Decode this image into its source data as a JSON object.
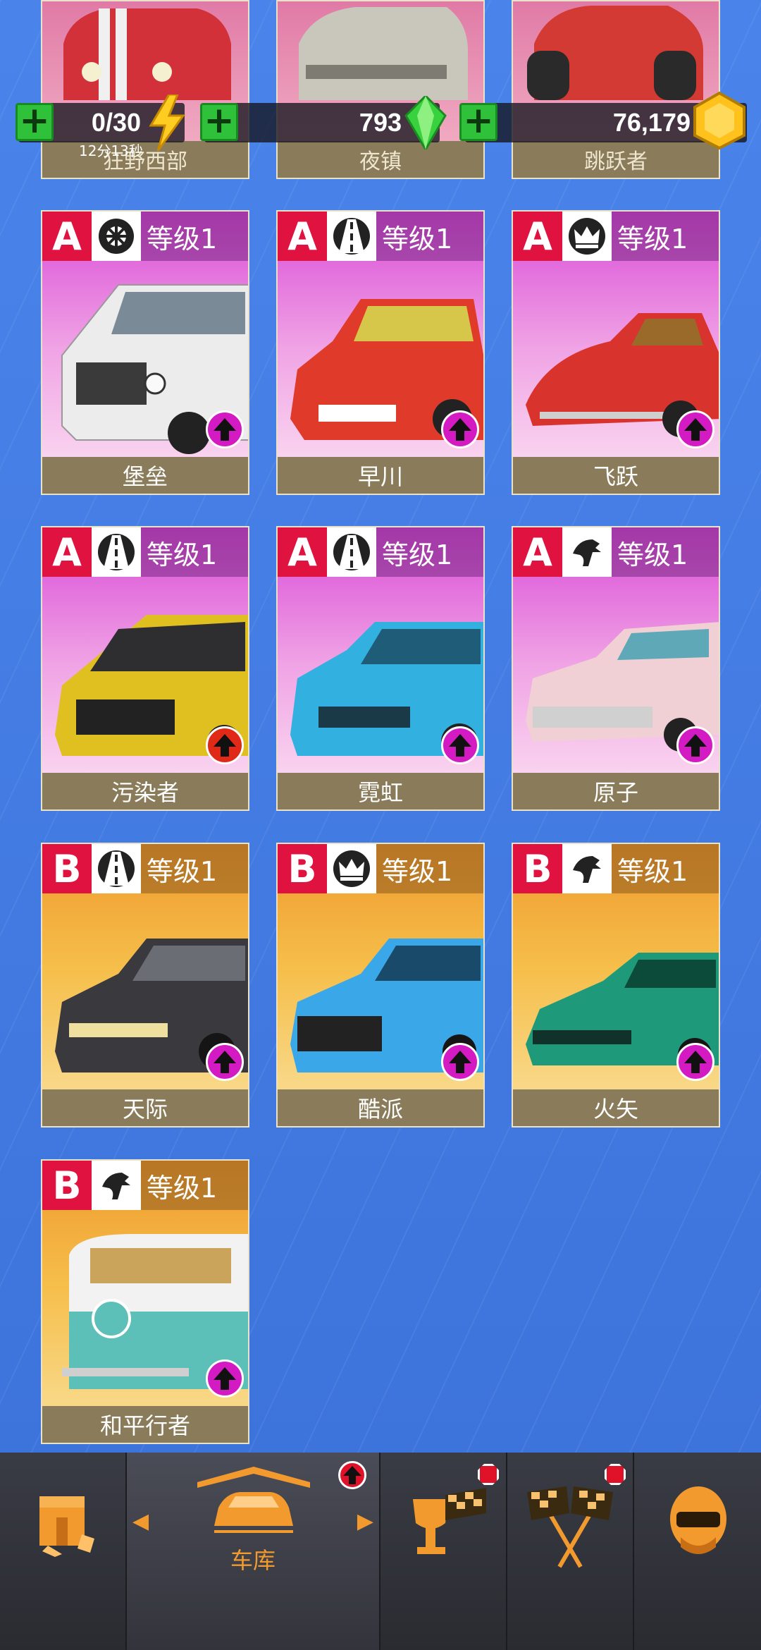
{
  "currency": {
    "energy": "0/30",
    "energy_timer": "12分13秒",
    "gems": "793",
    "coins": "76,179"
  },
  "top_cards": [
    {
      "name": "狂野西部"
    },
    {
      "name": "夜镇"
    },
    {
      "name": "跳跃者"
    }
  ],
  "cards": [
    {
      "grade": "A",
      "type_icon": "wheel-icon",
      "level": "等级1",
      "name": "堡垒",
      "car_color": "#e8e8e8",
      "upgrade": "magenta"
    },
    {
      "grade": "A",
      "type_icon": "road-icon",
      "level": "等级1",
      "name": "早川",
      "car_color": "#e03a2a",
      "upgrade": "magenta"
    },
    {
      "grade": "A",
      "type_icon": "crown-icon",
      "level": "等级1",
      "name": "飞跃",
      "car_color": "#d8332c",
      "upgrade": "magenta"
    },
    {
      "grade": "A",
      "type_icon": "road-icon",
      "level": "等级1",
      "name": "污染者",
      "car_color": "#e0c020",
      "upgrade": "red"
    },
    {
      "grade": "A",
      "type_icon": "road-icon",
      "level": "等级1",
      "name": "霓虹",
      "car_color": "#32b0e0",
      "upgrade": "magenta"
    },
    {
      "grade": "A",
      "type_icon": "horse-icon",
      "level": "等级1",
      "name": "原子",
      "car_color": "#f0d0d4",
      "upgrade": "magenta"
    },
    {
      "grade": "B",
      "type_icon": "road-icon",
      "level": "等级1",
      "name": "天际",
      "car_color": "#3a3a3e",
      "upgrade": "magenta"
    },
    {
      "grade": "B",
      "type_icon": "crown-icon",
      "level": "等级1",
      "name": "酷派",
      "car_color": "#3aa8e8",
      "upgrade": "magenta"
    },
    {
      "grade": "B",
      "type_icon": "horse-icon",
      "level": "等级1",
      "name": "火矢",
      "car_color": "#1e9a7a",
      "upgrade": "magenta"
    },
    {
      "grade": "B",
      "type_icon": "horse-icon",
      "level": "等级1",
      "name": "和平行者",
      "car_color": "#5cc0b8",
      "upgrade": "magenta"
    }
  ],
  "nav": {
    "garage_label": "车库"
  }
}
